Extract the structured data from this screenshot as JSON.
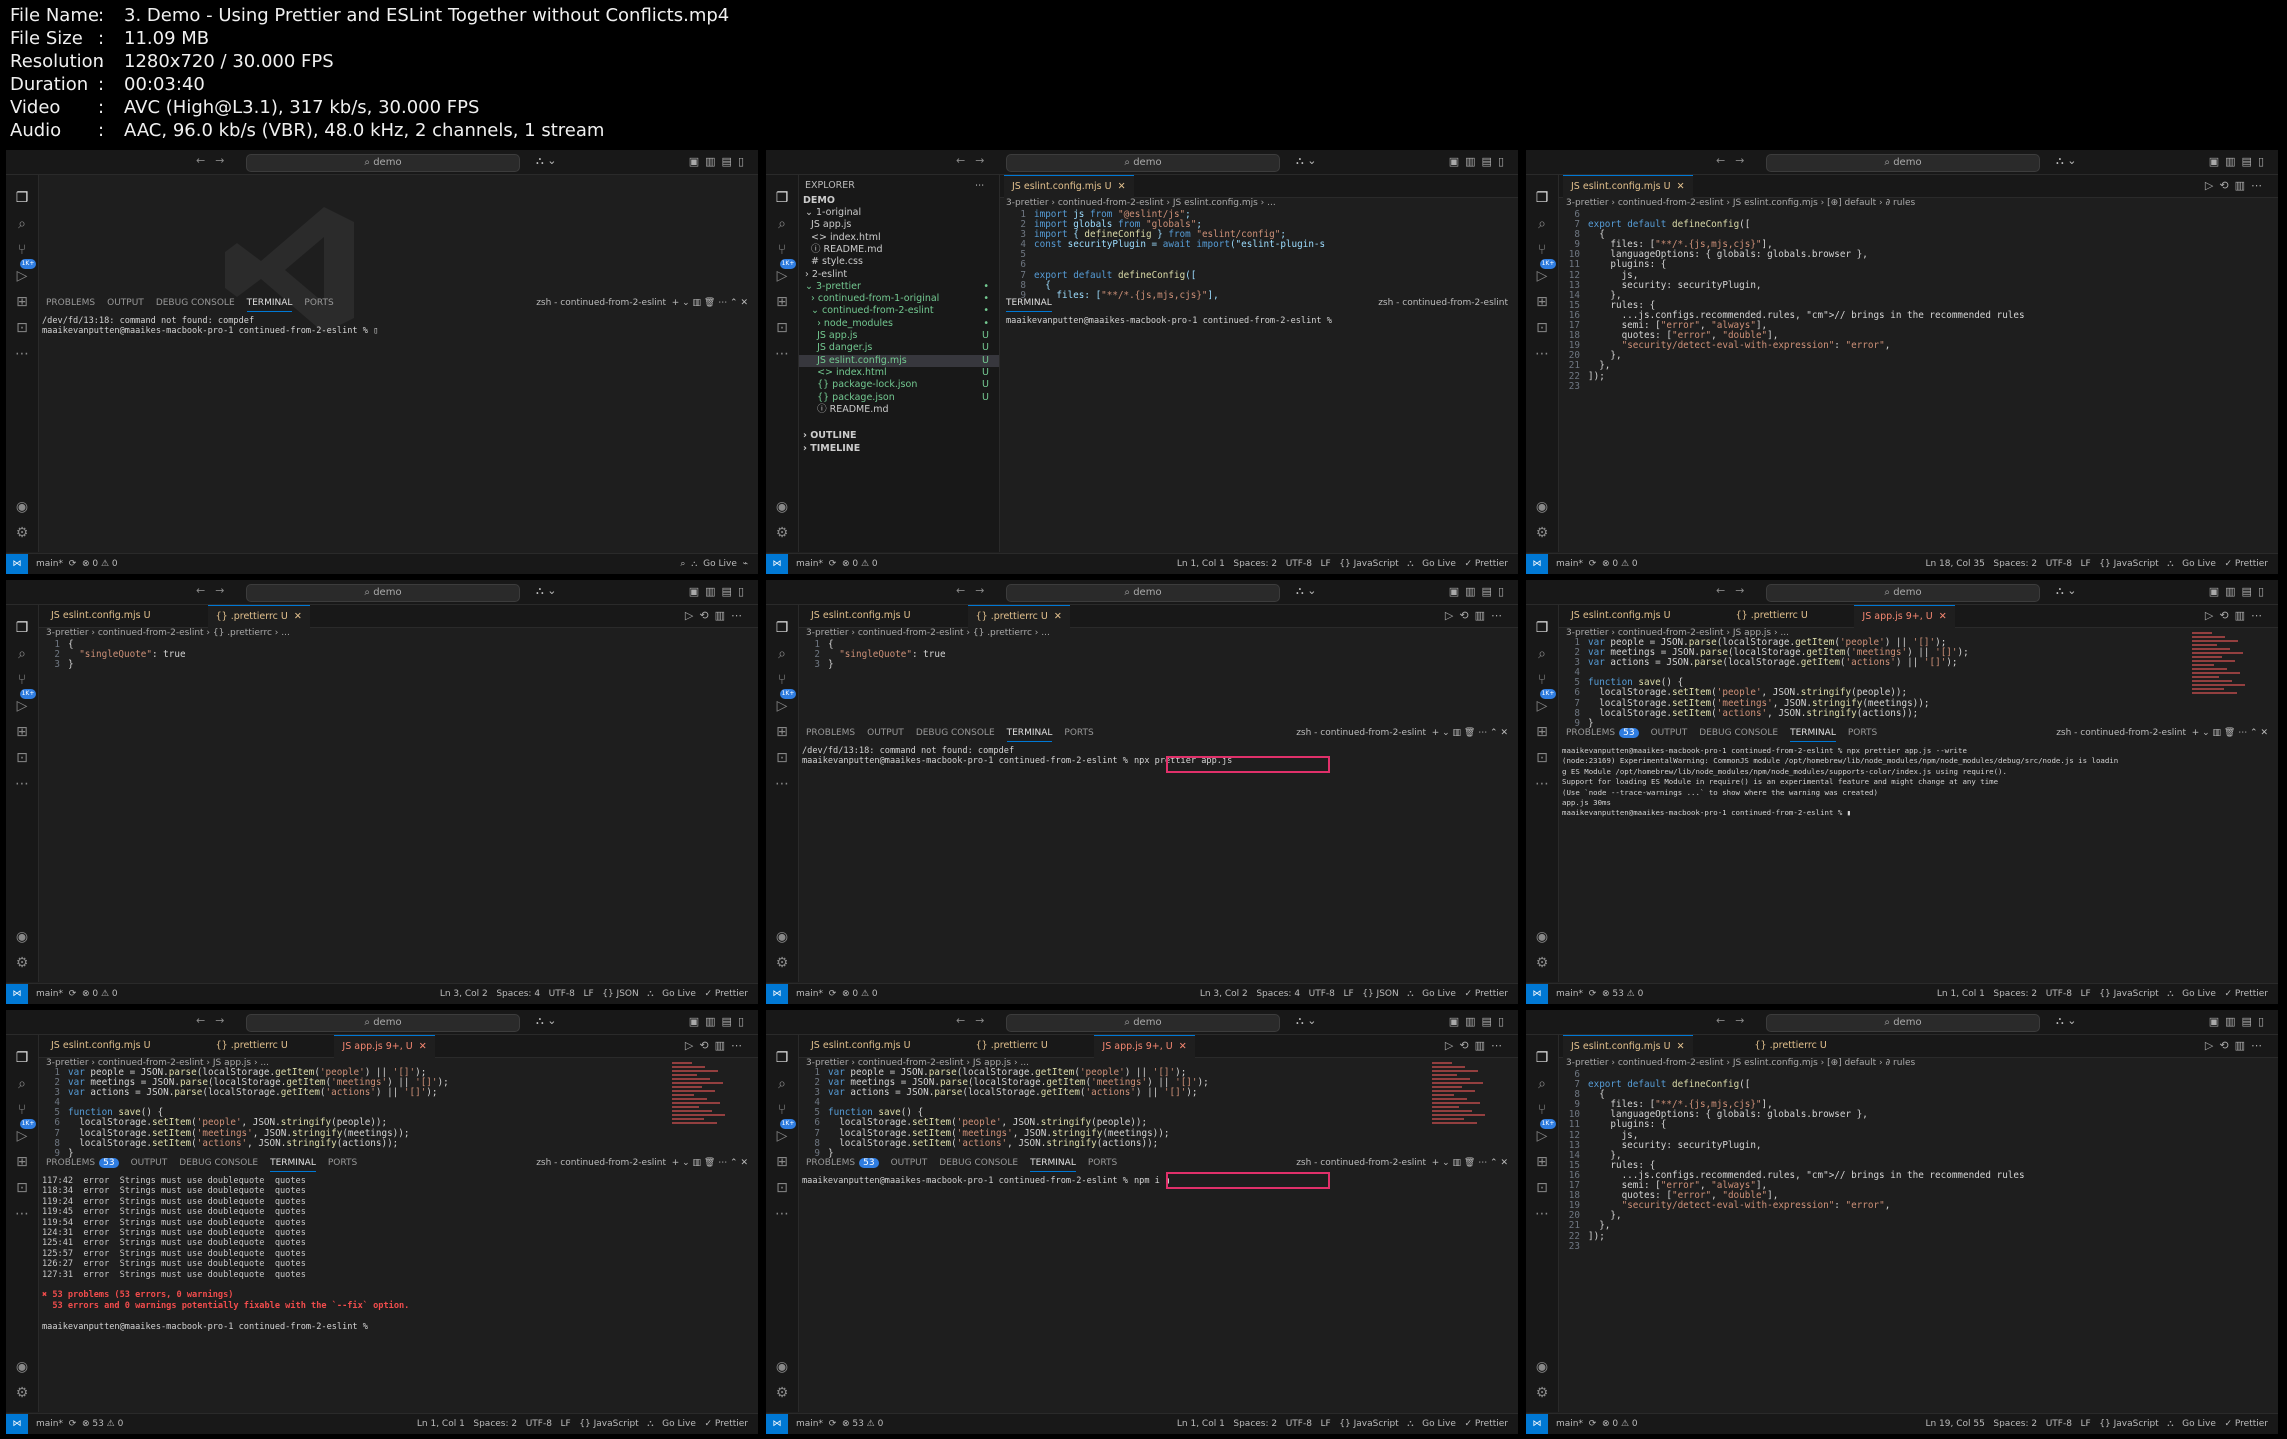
{
  "info": {
    "file_name_key": "File Name",
    "file_name": "3. Demo - Using Prettier and ESLint Together without Conflicts.mp4",
    "file_size_key": "File Size",
    "file_size": "11.09 MB",
    "resolution_key": "Resolution",
    "resolution": "1280x720 / 30.000 FPS",
    "duration_key": "Duration",
    "duration": "00:03:40",
    "video_key": "Video",
    "video": "AVC (High@L3.1), 317 kb/s, 30.000 FPS",
    "audio_key": "Audio",
    "audio": "AAC, 96.0 kb/s (VBR), 48.0 kHz, 2 channels, 1 stream"
  },
  "common": {
    "search": "⌕ demo",
    "branch": "main*",
    "go_live": "Go Live",
    "prettier": "✓ Prettier",
    "panel_tabs": [
      "PROBLEMS",
      "OUTPUT",
      "DEBUG CONSOLE",
      "TERMINAL",
      "PORTS"
    ],
    "terminal_name": "zsh - continued-from-2-eslint",
    "prompt": "maaikevanputten@maaikes-macbook-pro-1 continued-from-2-eslint %",
    "compdef": "/dev/fd/13:18: command not found: compdef",
    "badge": "1K+",
    "colors": {
      "accent": "#0078d4",
      "highlight": "#e0306a",
      "error": "#f14c4c"
    }
  },
  "tiles": {
    "t1": {
      "status_left": "main*  ⟳  ⊗ 0 ⚠ 0",
      "status_right": "⌕  ⛬  Go Live  ⌁"
    },
    "t2": {
      "explorer_title": "EXPLORER",
      "root": "DEMO",
      "tree": [
        {
          "label": "⌄ 1-original",
          "u": ""
        },
        {
          "label": "  JS app.js",
          "u": ""
        },
        {
          "label": "  <> index.html",
          "u": ""
        },
        {
          "label": "  ⓘ README.md",
          "u": ""
        },
        {
          "label": "  # style.css",
          "u": ""
        },
        {
          "label": "› 2-eslint",
          "u": ""
        },
        {
          "label": "⌄ 3-prettier",
          "u": "•"
        },
        {
          "label": "  › continued-from-1-original",
          "u": "•"
        },
        {
          "label": "  ⌄ continued-from-2-eslint",
          "u": "•"
        },
        {
          "label": "    › node_modules",
          "u": "•"
        },
        {
          "label": "    JS app.js",
          "u": "U"
        },
        {
          "label": "    JS danger.js",
          "u": "U"
        },
        {
          "label": "    JS eslint.config.mjs",
          "u": "U"
        },
        {
          "label": "    <> index.html",
          "u": "U"
        },
        {
          "label": "    {} package-lock.json",
          "u": "U"
        },
        {
          "label": "    {} package.json",
          "u": "U"
        },
        {
          "label": "    ⓘ README.md",
          "u": ""
        }
      ],
      "outline": "› OUTLINE",
      "timeline": "› TIMELINE",
      "tab": "JS eslint.config.mjs U  ✕",
      "crumb": "3-prettier › continued-from-2-eslint › JS eslint.config.mjs › ...",
      "lines": [
        "import js from \"@eslint/js\";",
        "import globals from \"globals\";",
        "import { defineConfig } from \"eslint/config\";",
        "const securityPlugin = await import(\"eslint-plugin-s",
        "",
        "",
        "export default defineConfig([",
        "  {",
        "    files: [\"**/*.{js,mjs,cjs}\"],"
      ],
      "status_left": "main*  ⟳  ⊗ 0 ⚠ 0",
      "status_right": "Ln 1, Col 1   Spaces: 2   UTF-8   LF   {} JavaScript   ⛬   Go Live   ✓ Prettier"
    },
    "t3": {
      "tab": "JS eslint.config.mjs U  ✕",
      "crumb": "3-prettier › continued-from-2-eslint › JS eslint.config.mjs › [⊕] default › ∂ rules",
      "line_numbers": [
        "6",
        "7",
        "8",
        "9",
        "10",
        "11",
        "12",
        "13",
        "14",
        "15",
        "16",
        "17",
        "18",
        "19",
        "20",
        "21",
        "22",
        "23"
      ],
      "lines": [
        "",
        "export default defineConfig([",
        "  {",
        "    files: [\"**/*.{js,mjs,cjs}\"],",
        "    languageOptions: { globals: globals.browser },",
        "    plugins: {",
        "      js,",
        "      security: securityPlugin,",
        "    },",
        "    rules: {",
        "      ...js.configs.recommended.rules, // brings in the recommended rules",
        "      semi: [\"error\", \"always\"],",
        "      quotes: [\"error\", \"double\"],",
        "      \"security/detect-eval-with-expression\": \"error\",",
        "    },",
        "  },",
        "]);",
        ""
      ],
      "status_left": "main*  ⟳  ⊗ 0 ⚠ 0",
      "status_right": "Ln 18, Col 35   Spaces: 2   UTF-8   LF   {} JavaScript   ⛬   Go Live   ✓ Prettier"
    },
    "t4": {
      "tabs": [
        "JS eslint.config.mjs U",
        "{} .prettierrc U  ✕"
      ],
      "crumb": "3-prettier › continued-from-2-eslint › {} .prettierrc › ...",
      "lines": [
        "{",
        "  \"singleQuote\": true",
        "}"
      ],
      "status_left": "main*  ⟳  ⊗ 0 ⚠ 0",
      "status_right": "Ln 3, Col 2   Spaces: 4   UTF-8   LF   {} JSON   ⛬   Go Live   ✓ Prettier"
    },
    "t5": {
      "tabs": [
        "JS eslint.config.mjs U",
        "{} .prettierrc U  ✕"
      ],
      "crumb": "3-prettier › continued-from-2-eslint › {} .prettierrc › ...",
      "lines": [
        "{",
        "  \"singleQuote\": true",
        "}"
      ],
      "command": "npx prettier app.js",
      "status_left": "main*  ⟳  ⊗ 0 ⚠ 0",
      "status_right": "Ln 3, Col 2   Spaces: 4   UTF-8   LF   {} JSON   ⛬   Go Live   ✓ Prettier"
    },
    "t6": {
      "tabs": [
        "JS eslint.config.mjs U",
        "{} .prettierrc U",
        "JS app.js 9+, U  ✕"
      ],
      "crumb": "3-prettier › continued-from-2-eslint › JS app.js › ...",
      "problems_count": "53",
      "term_lines": [
        "maaikevanputten@maaikes-macbook-pro-1 continued-from-2-eslint % npx prettier app.js --write",
        "(node:23169) ExperimentalWarning: CommonJS module /opt/homebrew/lib/node_modules/npm/node_modules/debug/src/node.js is loadin",
        "g ES Module /opt/homebrew/lib/node_modules/npm/node_modules/supports-color/index.js using require().",
        "Support for loading ES Module in require() is an experimental feature and might change at any time",
        "(Use `node --trace-warnings ...` to show where the warning was created)",
        "app.js 30ms",
        "maaikevanputten@maaikes-macbook-pro-1 continued-from-2-eslint % ▮"
      ],
      "status_left": "main*  ⟳  ⊗ 53 ⚠ 0",
      "status_right": "Ln 1, Col 1   Spaces: 2   UTF-8   LF   {} JavaScript   ⛬   Go Live   ✓ Prettier"
    },
    "t7": {
      "tabs": [
        "JS eslint.config.mjs U",
        "{} .prettierrc U",
        "JS app.js 9+, U  ✕"
      ],
      "crumb": "3-prettier › continued-from-2-eslint › JS app.js › ...",
      "problems_count": "53",
      "errors": [
        "117:42  error  Strings must use doublequote  quotes",
        "118:34  error  Strings must use doublequote  quotes",
        "119:24  error  Strings must use doublequote  quotes",
        "119:45  error  Strings must use doublequote  quotes",
        "119:54  error  Strings must use doublequote  quotes",
        "124:31  error  Strings must use doublequote  quotes",
        "125:41  error  Strings must use doublequote  quotes",
        "125:57  error  Strings must use doublequote  quotes",
        "126:27  error  Strings must use doublequote  quotes",
        "127:31  error  Strings must use doublequote  quotes"
      ],
      "summary1": "✖ 53 problems (53 errors, 0 warnings)",
      "summary2": "  53 errors and 0 warnings potentially fixable with the `--fix` option.",
      "status_left": "main*  ⟳  ⊗ 53 ⚠ 0",
      "status_right": "Ln 1, Col 1   Spaces: 2   UTF-8   LF   {} JavaScript   ⛬   Go Live   ✓ Prettier"
    },
    "t8": {
      "tabs": [
        "JS eslint.config.mjs U",
        "{} .prettierrc U",
        "JS app.js 9+, U  ✕"
      ],
      "crumb": "3-prettier › continued-from-2-eslint › JS app.js › ...",
      "problems_count": "53",
      "command": "npm i ▮",
      "status_left": "main*  ⟳  ⊗ 53 ⚠ 0",
      "status_right": "Ln 1, Col 1   Spaces: 2   UTF-8   LF   {} JavaScript   ⛬   Go Live   ✓ Prettier"
    },
    "t9": {
      "tabs": [
        "JS eslint.config.mjs U  ✕",
        "{} .prettierrc U"
      ],
      "crumb": "3-prettier › continued-from-2-eslint › JS eslint.config.mjs › [⊕] default › ∂ rules",
      "line_numbers": [
        "6",
        "7",
        "8",
        "9",
        "10",
        "11",
        "12",
        "13",
        "14",
        "15",
        "16",
        "17",
        "18",
        "19",
        "20",
        "21",
        "22",
        "23"
      ],
      "status_left": "main*  ⟳  ⊗ 0 ⚠ 0",
      "status_right": "Ln 19, Col 55   Spaces: 2   UTF-8   LF   {} JavaScript   ⛬   Go Live   ✓ Prettier"
    }
  },
  "appjs_lines": [
    "var people = JSON.parse(localStorage.getItem('people') || '[]');",
    "var meetings = JSON.parse(localStorage.getItem('meetings') || '[]');",
    "var actions = JSON.parse(localStorage.getItem('actions') || '[]');",
    "",
    "function save() {",
    "  localStorage.setItem('people', JSON.stringify(people));",
    "  localStorage.setItem('meetings', JSON.stringify(meetings));",
    "  localStorage.setItem('actions', JSON.stringify(actions));",
    "}"
  ],
  "icons": [
    "explorer-icon",
    "search-icon",
    "source-control-icon",
    "run-debug-icon",
    "extensions-icon",
    "remote-icon",
    "more-icon",
    "account-icon",
    "manage-gear-icon"
  ]
}
